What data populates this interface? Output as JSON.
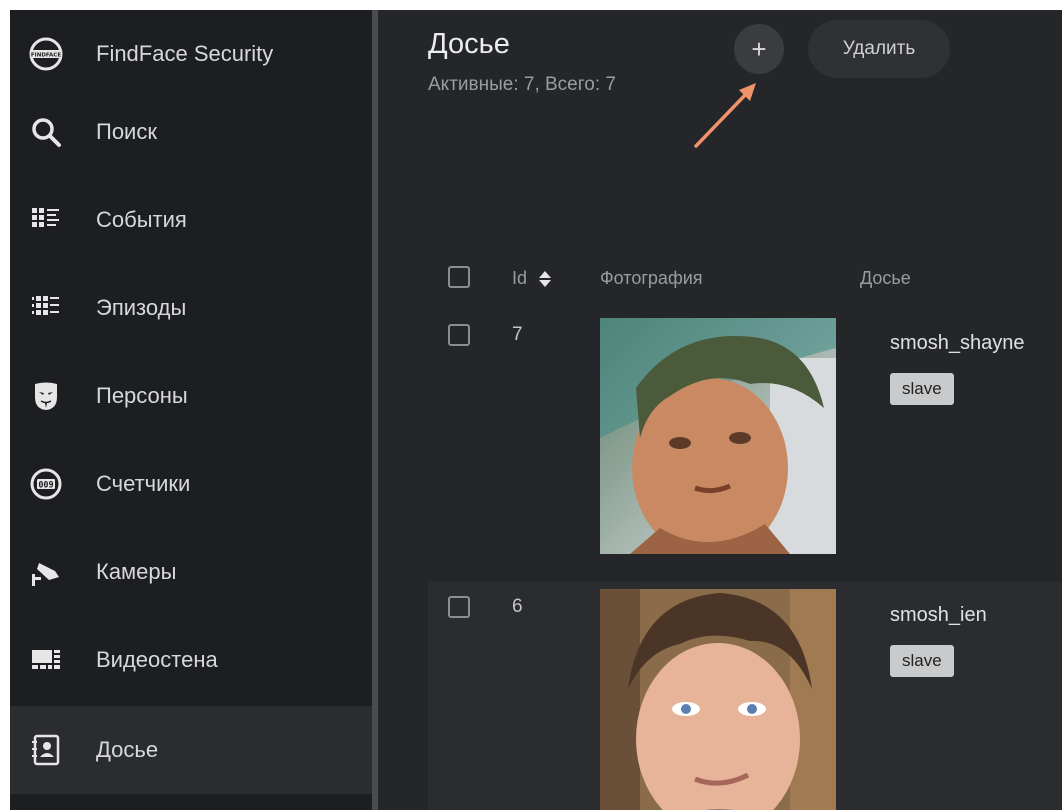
{
  "app": {
    "title": "FindFace Security"
  },
  "sidebar": {
    "items": [
      {
        "label": "Поиск",
        "icon": "search-icon"
      },
      {
        "label": "События",
        "icon": "events-grid-icon"
      },
      {
        "label": "Эпизоды",
        "icon": "episodes-icon"
      },
      {
        "label": "Персоны",
        "icon": "mask-icon"
      },
      {
        "label": "Счетчики",
        "icon": "counter-icon"
      },
      {
        "label": "Камеры",
        "icon": "camera-icon"
      },
      {
        "label": "Видеостена",
        "icon": "videowall-icon"
      },
      {
        "label": "Досье",
        "icon": "dossier-icon",
        "active": true
      }
    ]
  },
  "page": {
    "title": "Досье",
    "subtitle": "Активные: 7, Всего: 7",
    "add_label": "+",
    "delete_label": "Удалить"
  },
  "table": {
    "columns": {
      "id": "Id",
      "photo": "Фотография",
      "dossier": "Досье"
    },
    "rows": [
      {
        "id": "7",
        "name": "smosh_shayne",
        "tag": "slave"
      },
      {
        "id": "6",
        "name": "smosh_ien",
        "tag": "slave"
      }
    ]
  },
  "colors": {
    "accent_arrow": "#f0926a",
    "background": "#25262a",
    "sidebar": "#1d1e21"
  }
}
